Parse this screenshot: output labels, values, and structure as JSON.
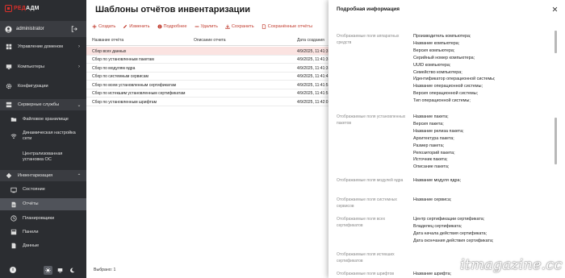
{
  "app": {
    "logo_left": "РЕД",
    "logo_right": "АДМ"
  },
  "user": {
    "name": "administrator",
    "avatar_icon": "user-circle-icon",
    "logout_icon": "logout-icon"
  },
  "sidebar": {
    "items": [
      {
        "label": "Управление доменом",
        "icon": "domain-icon",
        "chevron": "›"
      },
      {
        "label": "Компьютеры",
        "icon": "computer-icon",
        "chevron": "›"
      },
      {
        "label": "Конфигурации",
        "icon": "gear-icon",
        "chevron": ""
      },
      {
        "label": "Серверные службы",
        "icon": "server-icon",
        "chevron": "⌄"
      },
      {
        "label": "Файловое хранилище",
        "icon": "folder-icon",
        "chevron": ""
      },
      {
        "label": "Динамическая настройка сети",
        "icon": "network-icon",
        "chevron": ""
      },
      {
        "label": "Централизованная установка ОС",
        "icon": "install-icon",
        "chevron": ""
      },
      {
        "label": "Инвентаризация",
        "icon": "inventory-icon",
        "chevron": "⌃"
      },
      {
        "label": "Состояние",
        "icon": "state-icon",
        "chevron": ""
      },
      {
        "label": "Отчёты",
        "icon": "report-icon",
        "chevron": ""
      },
      {
        "label": "Планировщики",
        "icon": "scheduler-icon",
        "chevron": ""
      },
      {
        "label": "Панели",
        "icon": "panels-icon",
        "chevron": ""
      },
      {
        "label": "Данные",
        "icon": "data-icon",
        "chevron": ""
      }
    ]
  },
  "footer": {
    "info": "i",
    "theme_icon": "sun-icon",
    "monitor_icon": "monitor-icon",
    "moon_icon": "moon-icon"
  },
  "main": {
    "title": "Шаблоны отчётов инвентаризации",
    "toolbar": {
      "create": "Создать",
      "edit": "Изменить",
      "details": "Подробнее",
      "delete": "Удалить",
      "save": "Сохранить",
      "saved": "Сохранённые отчёты"
    },
    "columns": {
      "name": "Название отчёта",
      "description": "Описание отчета",
      "date": "Дата создания"
    },
    "rows": [
      {
        "name": "Сбор всех данных",
        "date": "4/9/2025, 11:41:3"
      },
      {
        "name": "Сбор по установленным пакетам",
        "date": "4/9/2025, 11:41:3"
      },
      {
        "name": "Сбор по модулям ядра",
        "date": "4/9/2025, 11:41:3"
      },
      {
        "name": "Сбор по системным сервисам",
        "date": "4/9/2025, 11:41:4"
      },
      {
        "name": "Сбор по всем установленным сертификатам",
        "date": "4/9/2025, 11:41:5"
      },
      {
        "name": "Сбор по истекшим установленным сертификатам",
        "date": "4/9/2025, 11:41:5"
      },
      {
        "name": "Сбор по установленным шрифтам",
        "date": "4/9/2025, 11:42:0"
      }
    ],
    "selected_count": "Выбрано: 1"
  },
  "panel": {
    "title": "Подробная информация",
    "close_icon": "close-icon",
    "props": [
      {
        "key": "Отображаемые поля аппаратных средств",
        "values": [
          "Производитель компьютера;",
          "Название компьютера;",
          "Версия компьютера;",
          "Серийный номер компьютера;",
          "UUID компьютера;",
          "Семейство компьютера;",
          "Идентификатор операционной системы;",
          "Название операционной системы;",
          "Версия операционной системы;",
          "Тип операционной системы;"
        ]
      },
      {
        "key": "Отображаемые поля установленных пакетов",
        "values": [
          "Название пакета;",
          "Версия пакета;",
          "Название релиза пакета;",
          "Архитектура пакета;",
          "Размер пакета;",
          "Репозиторий пакета;",
          "Источник пакета;",
          "Описание пакета;"
        ]
      },
      {
        "key": "Отображаемые поля модулей ядра",
        "values": [
          "Название модуля ядра;"
        ]
      },
      {
        "key": "Отображаемые поля системных сервисов",
        "values": [
          "Название сервиса;"
        ]
      },
      {
        "key": "Отображаемые поля всех сертификатов",
        "values": [
          "Центр сертификации сертификата;",
          "Владелец сертификата;",
          "Дата начала действия сертификата;",
          "Дата окончания действия сертификата;"
        ]
      },
      {
        "key": "Отображаемые поля истекших сертификатов",
        "values": []
      },
      {
        "key": "Отображаемые поля шрифтов",
        "values": [
          "Название шрифта;"
        ]
      }
    ]
  },
  "watermark": "itmagazine.cc",
  "colors": {
    "sidebar_bg": "#2b2d31",
    "accent": "#c0392b",
    "selected_row": "#fbe3e1"
  }
}
